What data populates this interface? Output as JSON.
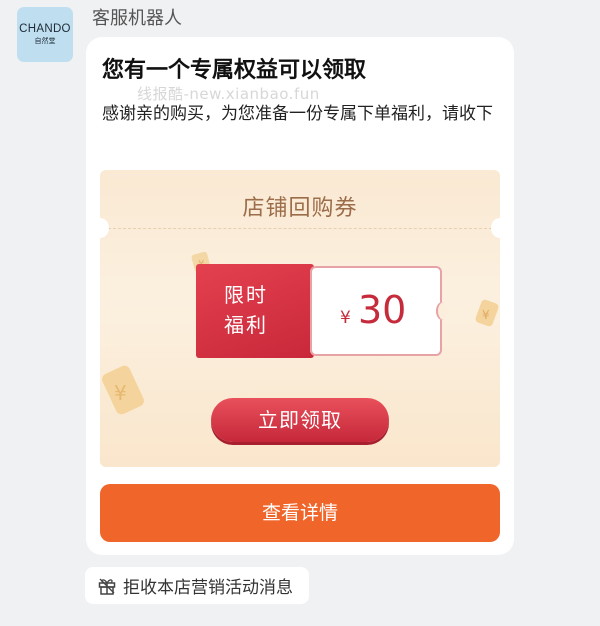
{
  "avatar": {
    "brand": "CHANDO",
    "brand_cn": "自然堂"
  },
  "sender": {
    "name": "客服机器人"
  },
  "message": {
    "title": "您有一个专属权益可以领取",
    "body": "感谢亲的购买，为您准备一份专属下单福利，请收下",
    "watermark": "线报酷-new.xianbao.fun"
  },
  "coupon": {
    "title": "店铺回购券",
    "tag": "限时福利",
    "currency": "¥",
    "amount": "30",
    "claim_label": "立即领取"
  },
  "detail_button": {
    "label": "查看详情"
  },
  "reject_button": {
    "label": "拒收本店营销活动消息",
    "icon": "gift-icon"
  },
  "colors": {
    "accent_orange": "#f0662a",
    "coupon_red": "#c8283a",
    "coupon_bg": "#fae9d3"
  }
}
